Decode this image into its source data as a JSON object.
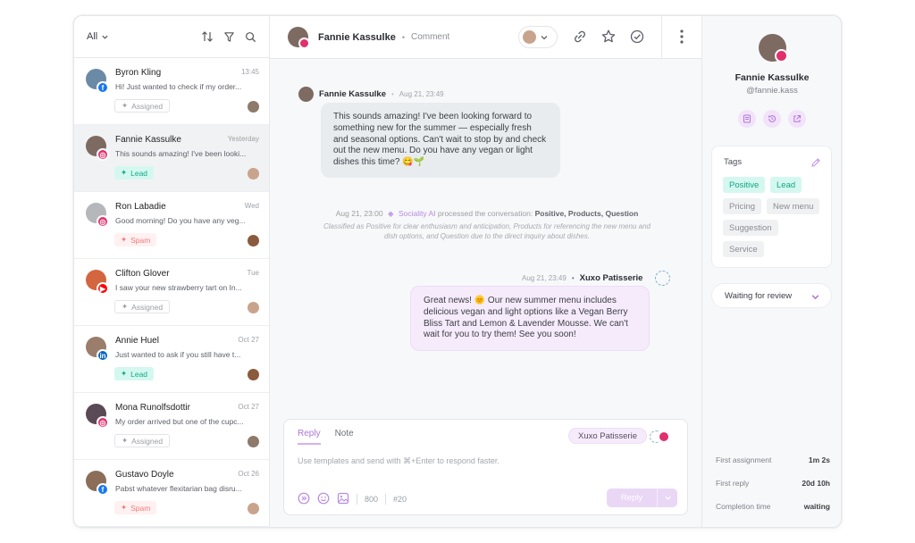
{
  "left": {
    "filter_label": "All",
    "conversations": [
      {
        "name": "Byron Kling",
        "time": "13:45",
        "snippet": "Hi! Just wanted to check if my order...",
        "tag": "Assigned",
        "tag_type": "assigned",
        "network": "facebook",
        "avatar_color": "#6b8aa6",
        "agent_color": "#8d7a6b"
      },
      {
        "name": "Fannie Kassulke",
        "time": "Yesterday",
        "snippet": "This sounds amazing! I've been looki...",
        "tag": "Lead",
        "tag_type": "lead",
        "network": "instagram",
        "avatar_color": "#7d6b62",
        "agent_color": "#c9a48d"
      },
      {
        "name": "Ron Labadie",
        "time": "Wed",
        "snippet": "Good morning! Do you have any veg...",
        "tag": "Spam",
        "tag_type": "spam",
        "network": "instagram",
        "avatar_color": "#b5b7bb",
        "agent_color": "#8a5a3c"
      },
      {
        "name": "Clifton Glover",
        "time": "Tue",
        "snippet": "I saw your new strawberry tart on In...",
        "tag": "Assigned",
        "tag_type": "assigned",
        "network": "youtube",
        "avatar_color": "#d4663f",
        "agent_color": "#c9a48d"
      },
      {
        "name": "Annie Huel",
        "time": "Oct 27",
        "snippet": "Just wanted to ask if you still have t...",
        "tag": "Lead",
        "tag_type": "lead",
        "network": "linkedin",
        "avatar_color": "#9a7d6a",
        "agent_color": "#8a5a3c"
      },
      {
        "name": "Mona Runolfsdottir",
        "time": "Oct 27",
        "snippet": "My order arrived but one of the cupc...",
        "tag": "Assigned",
        "tag_type": "assigned",
        "network": "instagram",
        "avatar_color": "#5a4a55",
        "agent_color": "#8d7a6b"
      },
      {
        "name": "Gustavo Doyle",
        "time": "Oct 26",
        "snippet": "Pabst whatever flexitarian bag disru...",
        "tag": "Spam",
        "tag_type": "spam",
        "network": "facebook",
        "avatar_color": "#8c6e58",
        "agent_color": "#c9a48d"
      }
    ]
  },
  "header": {
    "name": "Fannie Kassulke",
    "type": "Comment"
  },
  "messages": {
    "incoming": {
      "name": "Fannie Kassulke",
      "time": "Aug 21, 23:49",
      "text": "This sounds amazing! I've been looking forward to something new for the summer — especially fresh and seasonal options. Can't wait to stop by and check out the new menu. Do you have any vegan or light dishes this time? 😋🌱"
    },
    "system": {
      "time": "Aug 21, 23:00",
      "actor": "Sociality AI",
      "action": "processed the conversation:",
      "tags": "Positive, Products, Question",
      "detail": "Classified as Positive for clear enthusiasm and anticipation, Products for referencing the new menu and dish options, and Question due to the direct inquiry about dishes."
    },
    "outgoing": {
      "name": "Xuxo Patisserie",
      "time": "Aug 21, 23:49",
      "text": "Great news! 🌞 Our new summer menu includes delicious vegan and light options like a Vegan Berry Bliss Tart and Lemon & Lavender Mousse. We can't wait for you to try them! See you soon!"
    }
  },
  "composer": {
    "tab_reply": "Reply",
    "tab_note": "Note",
    "sender": "Xuxo Patisserie",
    "placeholder": "Use templates and send with ⌘+Enter to respond faster.",
    "char_count": "800",
    "tag_count": "#20",
    "send_label": "Reply"
  },
  "profile": {
    "name": "Fannie Kassulke",
    "handle": "@fannie.kass",
    "tags_title": "Tags",
    "tags": [
      {
        "label": "Positive",
        "active": true
      },
      {
        "label": "Lead",
        "active": true
      },
      {
        "label": "Pricing",
        "active": false
      },
      {
        "label": "New menu",
        "active": false
      },
      {
        "label": "Suggestion",
        "active": false
      },
      {
        "label": "Service",
        "active": false
      }
    ],
    "status": "Waiting for review",
    "stats": [
      {
        "label": "First assignment",
        "value": "1m 2s"
      },
      {
        "label": "First reply",
        "value": "20d 10h"
      },
      {
        "label": "Completion time",
        "value": "waiting"
      }
    ]
  },
  "colors": {
    "accent": "#b076d9",
    "lead_green": "#14a585",
    "instagram": "#e1306c",
    "facebook": "#1877f2",
    "youtube": "#ff0000",
    "linkedin": "#0a66c2"
  }
}
